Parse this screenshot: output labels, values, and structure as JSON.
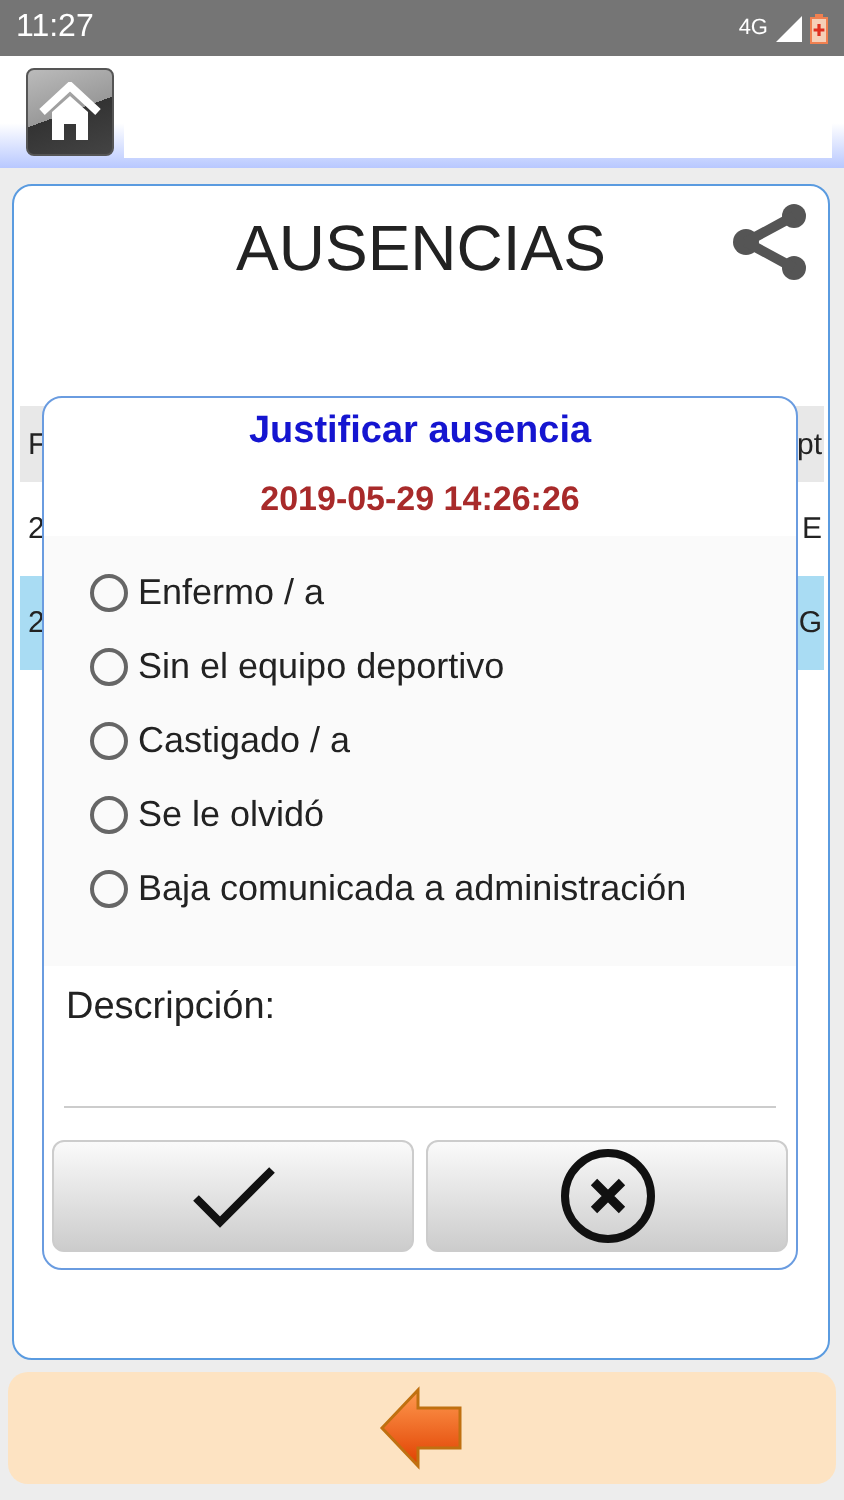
{
  "status_bar": {
    "time": "11:27",
    "network": "4G"
  },
  "page": {
    "title": "AUSENCIAS"
  },
  "table": {
    "columns": [
      "F",
      "pt"
    ],
    "rows": [
      {
        "cells": [
          "2",
          "E"
        ],
        "selected": false
      },
      {
        "cells": [
          "2",
          "G"
        ],
        "selected": true
      }
    ]
  },
  "dialog": {
    "title": "Justificar ausencia",
    "date": "2019-05-29 14:26:26",
    "options": [
      {
        "label": "Enfermo / a",
        "selected": false
      },
      {
        "label": "Sin el equipo deportivo",
        "selected": false
      },
      {
        "label": "Castigado / a",
        "selected": false
      },
      {
        "label": "Se le olvidó",
        "selected": false
      },
      {
        "label": "Baja comunicada a administración",
        "selected": false
      }
    ],
    "description_label": "Descripción:",
    "buttons": [
      {
        "kind": "confirm"
      },
      {
        "kind": "cancel"
      }
    ]
  }
}
